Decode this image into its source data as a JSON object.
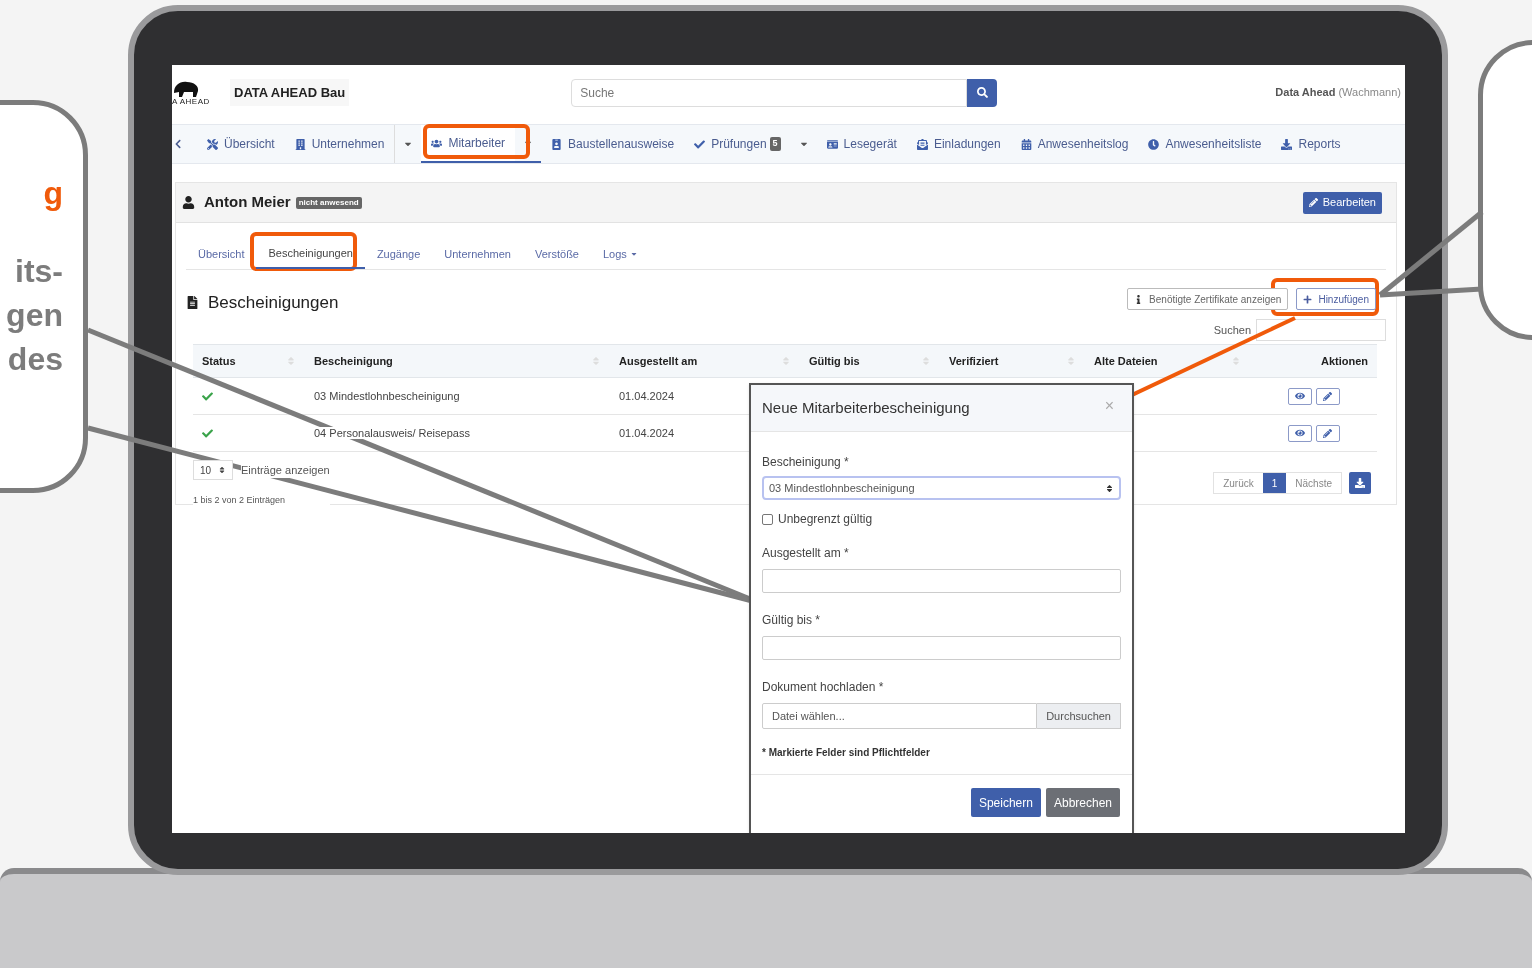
{
  "left_callout": {
    "heading": "g",
    "lines": [
      "its-",
      "gen",
      "des"
    ]
  },
  "app": {
    "logo_text": "A AHEAD",
    "brand": "DATA AHEAD Bau",
    "search": {
      "placeholder": "Suche"
    },
    "user": {
      "name": "Data Ahead",
      "role": "(Wachmann)"
    },
    "nav": [
      {
        "label": "Übersicht",
        "selected": false,
        "dropdown": false
      },
      {
        "label": "Unternehmen",
        "selected": false,
        "dropdown": true
      },
      {
        "label": "Mitarbeiter",
        "selected": true,
        "dropdown": true
      },
      {
        "label": "Baustellenausweise",
        "selected": false,
        "dropdown": false
      },
      {
        "label": "Prüfungen",
        "badge": "5",
        "selected": false,
        "dropdown": true
      },
      {
        "label": "Lesegerät",
        "selected": false,
        "dropdown": false
      },
      {
        "label": "Einladungen",
        "selected": false,
        "dropdown": false
      },
      {
        "label": "Anwesenheitslog",
        "selected": false,
        "dropdown": false
      },
      {
        "label": "Anwesenheitsliste",
        "selected": false,
        "dropdown": false
      },
      {
        "label": "Reports",
        "selected": false,
        "dropdown": false
      }
    ],
    "person": {
      "name": "Anton Meier",
      "status": "nicht anwesend"
    },
    "edit_button": "Bearbeiten",
    "subtabs": [
      {
        "label": "Übersicht",
        "selected": false,
        "dropdown": false
      },
      {
        "label": "Bescheinigungen",
        "selected": true,
        "dropdown": false
      },
      {
        "label": "Zugänge",
        "selected": false,
        "dropdown": false
      },
      {
        "label": "Unternehmen",
        "selected": false,
        "dropdown": false
      },
      {
        "label": "Verstöße",
        "selected": false,
        "dropdown": false
      },
      {
        "label": "Logs",
        "selected": false,
        "dropdown": true
      }
    ],
    "section_title": "Bescheinigungen",
    "info_button": "Benötigte Zertifikate anzeigen",
    "add_button": "Hinzufügen",
    "table_search_label": "Suchen",
    "columns": [
      "Status",
      "Bescheinigung",
      "Ausgestellt am",
      "Gültig bis",
      "Verifiziert",
      "Alte Dateien",
      "Aktionen"
    ],
    "rows": [
      {
        "valid": true,
        "certificate": "03 Mindestlohnbescheinigung",
        "issued": "01.04.2024"
      },
      {
        "valid": true,
        "certificate": "04 Personalausweis/ Reisepass",
        "issued": "01.04.2024"
      }
    ],
    "page_size": "10",
    "page_size_label": "Einträge anzeigen",
    "info": "1 bis 2 von 2 Einträgen",
    "pagination": {
      "prev": "Zurück",
      "pages": [
        {
          "label": "1",
          "selected": true
        }
      ],
      "next": "Nächste"
    },
    "modal": {
      "title": "Neue Mitarbeiterbescheinigung",
      "close": "×",
      "fields": [
        {
          "kind": "select",
          "label": "Bescheinigung *",
          "value": "03 Mindestlohnbescheinigung"
        },
        {
          "kind": "checkbox",
          "label": "Unbegrenzt gültig",
          "checked": false
        },
        {
          "kind": "text",
          "label": "Ausgestellt am *"
        },
        {
          "kind": "text",
          "label": "Gültig bis *"
        },
        {
          "kind": "file",
          "label": "Dokument hochladen *",
          "placeholder": "Datei wählen...",
          "button": "Durchsuchen"
        }
      ],
      "note": "* Markierte Felder sind Pflichtfelder",
      "save": "Speichern",
      "cancel": "Abbrechen"
    }
  }
}
